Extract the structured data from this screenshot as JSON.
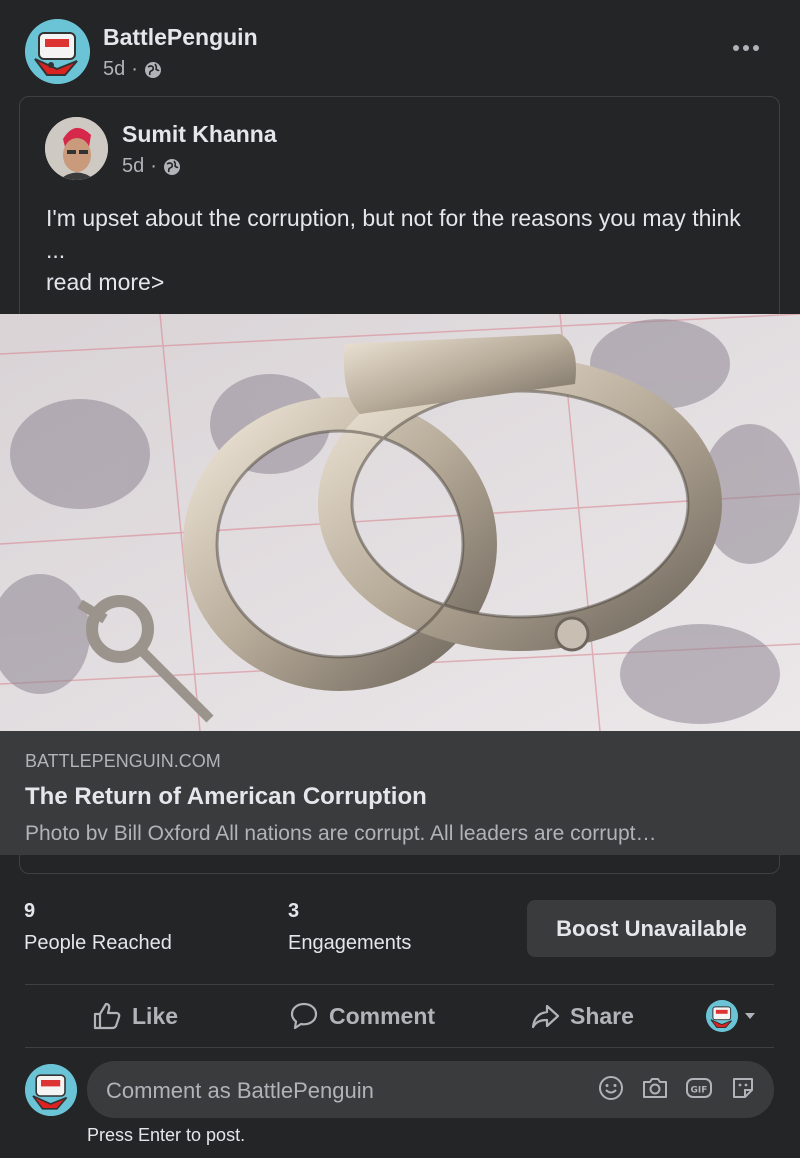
{
  "author": {
    "name": "BattlePenguin",
    "time": "5d",
    "sep": "·"
  },
  "shared_post": {
    "author": "Sumit Khanna",
    "time": "5d",
    "sep": "·",
    "text": "I'm upset about the corruption, but not for the reasons you may think ...",
    "read_more": "read more",
    "read_more_chevron": ">"
  },
  "link": {
    "domain": "BATTLEPENGUIN.COM",
    "title": "The Return of American Corruption",
    "description": "Photo bv Bill Oxford All nations are corrupt. All leaders are corrupt…"
  },
  "stats": {
    "people_reached_value": "9",
    "people_reached_label": "People Reached",
    "engagements_value": "3",
    "engagements_label": "Engagements",
    "boost_label": "Boost Unavailable"
  },
  "actions": {
    "like": "Like",
    "comment": "Comment",
    "share": "Share"
  },
  "composer": {
    "placeholder": "Comment as BattlePenguin",
    "hint": "Press Enter to post."
  },
  "icons": {
    "more": "more-options-icon",
    "globe": "globe-icon",
    "like": "thumbs-up-icon",
    "comment": "speech-bubble-icon",
    "share": "share-arrow-icon",
    "emoji": "smiley-icon",
    "camera": "camera-icon",
    "gif": "gif-icon",
    "sticker": "sticker-icon"
  }
}
